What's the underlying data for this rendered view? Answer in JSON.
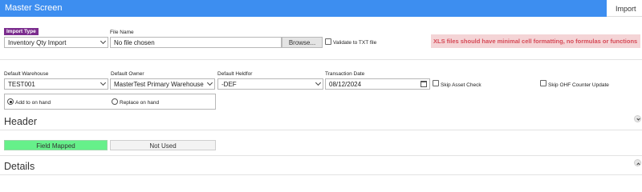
{
  "window": {
    "title": "Master Screen",
    "tab_import": "Import"
  },
  "import_type": {
    "badge": "Import Type",
    "value": "Inventory Qty Import"
  },
  "file": {
    "label": "File Name",
    "value": "No file chosen",
    "browse": "Browse...",
    "validate_label": "Validate to TXT file"
  },
  "warning": "XLS files should have minimal cell formatting, no formulas or functions",
  "defaults": {
    "warehouse_label": "Default Warehouse",
    "warehouse_value": "TEST001",
    "owner_label": "Default Owner",
    "owner_value": "MasterTest Primary Warehouse",
    "heldfor_label": "Default Heldfor",
    "heldfor_value": "-DEF",
    "date_label": "Transaction Date",
    "date_value": "08/12/2024"
  },
  "options": {
    "skip_asset": "Skip Asset Check",
    "skip_ohf": "Skip OHF Counter Update"
  },
  "mode": {
    "add": "Add to on hand",
    "replace": "Replace on hand",
    "selected": "add"
  },
  "header_section": {
    "title": "Header",
    "mapped": "Field Mapped",
    "unused": "Not Used"
  },
  "details_section": {
    "title": "Details"
  },
  "colors": {
    "titlebar": "#3d8ef0",
    "badge": "#7b2d8e",
    "warning_bg": "#f4d4d6",
    "warning_text": "#d64a57",
    "mapped": "#66f08a"
  }
}
